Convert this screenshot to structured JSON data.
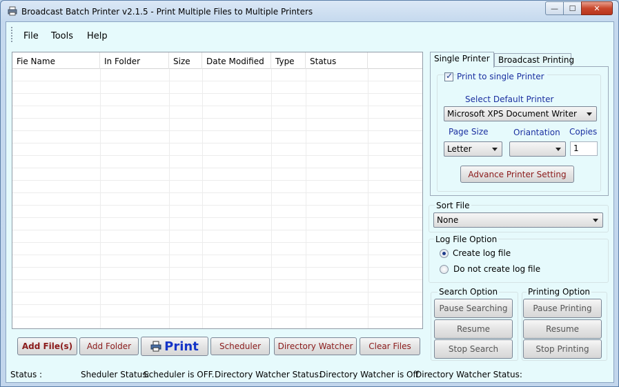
{
  "window": {
    "title": "Broadcast Batch Printer v2.1.5 - Print Multiple Files to Multiple Printers",
    "minimize_glyph": "—",
    "maximize_glyph": "☐",
    "close_glyph": "✕"
  },
  "menu": {
    "items": [
      "File",
      "Tools",
      "Help"
    ]
  },
  "file_grid": {
    "columns": [
      "Fie Name",
      "In Folder",
      "Size",
      "Date Modified",
      "Type",
      "Status"
    ],
    "rows": []
  },
  "buttons": {
    "add_files": "Add File(s)",
    "add_folder": "Add Folder",
    "print": "Print",
    "scheduler": "Scheduler",
    "directory_watcher": "Directory Watcher",
    "clear_files": "Clear Files"
  },
  "status_bar": {
    "status_label": "Status :",
    "scheduler_status_label": "Sheduler Status:",
    "scheduler_status_value": "Scheduler is OFF.",
    "dir_watcher_label": "Directory Watcher Status:",
    "dir_watcher_value": "Directory Watcher is Off",
    "dir_watcher_label2": "Directory Watcher Status:"
  },
  "tabs": [
    "Single Printer",
    "Broadcast Printing"
  ],
  "single_printer": {
    "print_to_single_label": "Print to single Printer",
    "print_to_single_checked": true,
    "select_default_label": "Select Default Printer",
    "default_printer": "Microsoft XPS Document Writer",
    "page_size_label": "Page Size",
    "page_size_value": "Letter",
    "orientation_label": "Oriantation",
    "orientation_value": "",
    "copies_label": "Copies",
    "copies_value": "1",
    "advance_button": "Advance Printer Setting"
  },
  "sort_file": {
    "label": "Sort File",
    "value": "None"
  },
  "log_file": {
    "label": "Log File Option",
    "options": [
      "Create log file",
      "Do not create log file"
    ],
    "selected": "Create log file"
  },
  "search_option": {
    "label": "Search Option",
    "pause": "Pause Searching",
    "resume": "Resume",
    "stop": "Stop Search"
  },
  "printing_option": {
    "label": "Printing Option",
    "pause": "Pause Printing",
    "resume": "Resume",
    "stop": "Stop Printing"
  },
  "colors": {
    "client_background": "#e6fafc",
    "label_blue": "#1a2fa0",
    "button_text_red": "#8b1a1a",
    "print_text_blue": "#1535c8"
  }
}
